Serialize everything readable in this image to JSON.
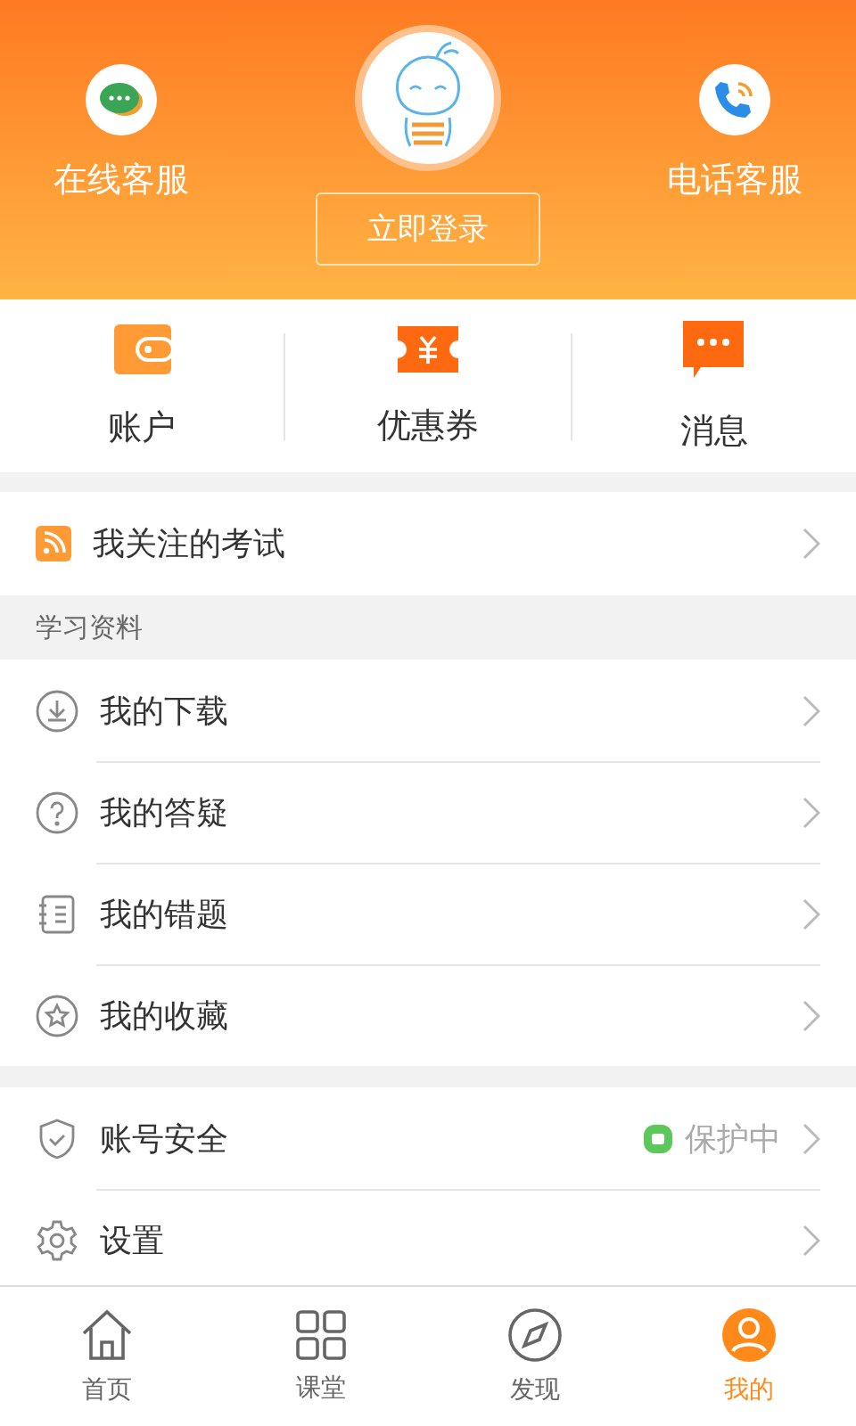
{
  "header": {
    "online_service": "在线客服",
    "login_button": "立即登录",
    "phone_service": "电话客服"
  },
  "quick_actions": [
    {
      "kind": "wallet",
      "label": "账户"
    },
    {
      "kind": "coupon",
      "label": "优惠券"
    },
    {
      "kind": "message",
      "label": "消息"
    }
  ],
  "followed_exams": {
    "label": "我关注的考试"
  },
  "study_materials": {
    "title": "学习资料",
    "items": [
      {
        "kind": "download",
        "label": "我的下载"
      },
      {
        "kind": "question",
        "label": "我的答疑"
      },
      {
        "kind": "mistakes",
        "label": "我的错题"
      },
      {
        "kind": "favorites",
        "label": "我的收藏"
      }
    ]
  },
  "account_items": [
    {
      "kind": "security",
      "label": "账号安全",
      "status": "保护中"
    },
    {
      "kind": "settings",
      "label": "设置"
    }
  ],
  "tabs": [
    {
      "kind": "home",
      "label": "首页",
      "selected": false
    },
    {
      "kind": "classroom",
      "label": "课堂",
      "selected": false
    },
    {
      "kind": "discover",
      "label": "发现",
      "selected": false
    },
    {
      "kind": "me",
      "label": "我的",
      "selected": true
    }
  ]
}
